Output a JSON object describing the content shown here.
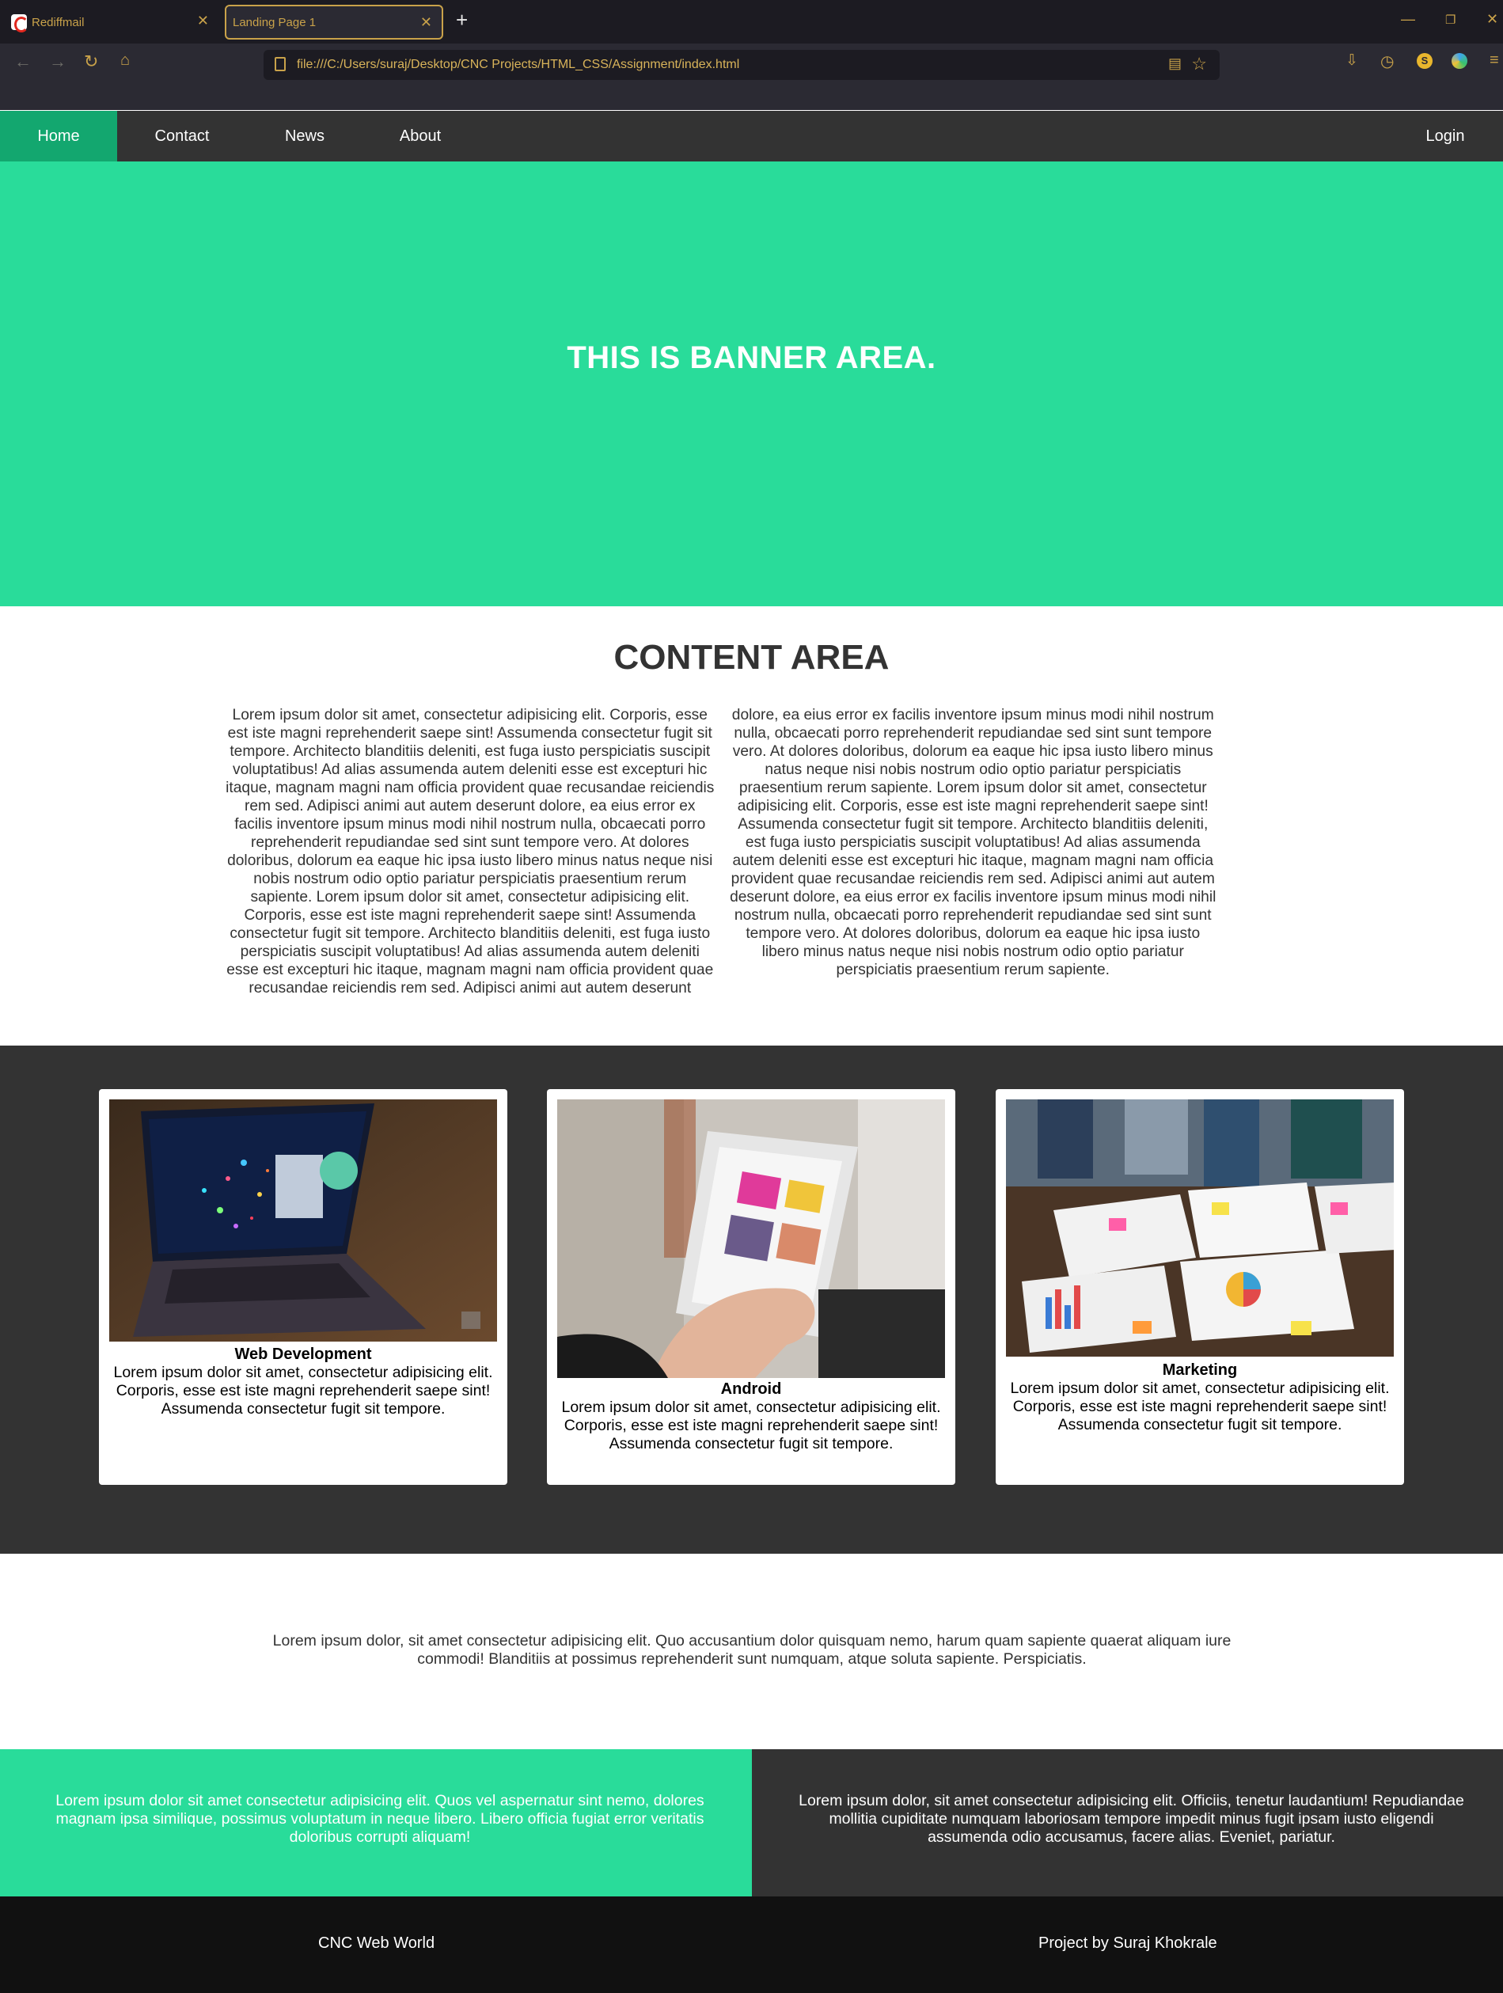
{
  "browser": {
    "tabs": [
      {
        "label": "Rediffmail",
        "active": false
      },
      {
        "label": "Landing Page 1",
        "active": true
      }
    ],
    "address": "file:///C:/Users/suraj/Desktop/CNC Projects/HTML_CSS/Assignment/index.html",
    "extension_badge": "S",
    "accent_color": "#c9a24a"
  },
  "nav": {
    "items": [
      "Home",
      "Contact",
      "News",
      "About"
    ],
    "login": "Login",
    "active_color": "#13a76f"
  },
  "banner": {
    "title": "THIS IS BANNER AREA.",
    "color": "#29dc9a"
  },
  "content": {
    "title": "CONTENT AREA",
    "body": "Lorem ipsum dolor sit amet, consectetur adipisicing elit. Corporis, esse est iste magni reprehenderit saepe sint! Assumenda consectetur fugit sit tempore. Architecto blanditiis deleniti, est fuga iusto perspiciatis suscipit voluptatibus! Ad alias assumenda autem deleniti esse est excepturi hic itaque, magnam magni nam officia provident quae recusandae reiciendis rem sed. Adipisci animi aut autem deserunt dolore, ea eius error ex facilis inventore ipsum minus modi nihil nostrum nulla, obcaecati porro reprehenderit repudiandae sed sint sunt tempore vero. At dolores doloribus, dolorum ea eaque hic ipsa iusto libero minus natus neque nisi nobis nostrum odio optio pariatur perspiciatis praesentium rerum sapiente. Lorem ipsum dolor sit amet, consectetur adipisicing elit. Corporis, esse est iste magni reprehenderit saepe sint! Assumenda consectetur fugit sit tempore. Architecto blanditiis deleniti, est fuga iusto perspiciatis suscipit voluptatibus! Ad alias assumenda autem deleniti esse est excepturi hic itaque, magnam magni nam officia provident quae recusandae reiciendis rem sed. Adipisci animi aut autem deserunt dolore, ea eius error ex facilis inventore ipsum minus modi nihil nostrum nulla, obcaecati porro reprehenderit repudiandae sed sint sunt tempore vero. At dolores doloribus, dolorum ea eaque hic ipsa iusto libero minus natus neque nisi nobis nostrum odio optio pariatur perspiciatis praesentium rerum sapiente. Lorem ipsum dolor sit amet, consectetur adipisicing elit. Corporis, esse est iste magni reprehenderit saepe sint! Assumenda consectetur fugit sit tempore. Architecto blanditiis deleniti, est fuga iusto perspiciatis suscipit voluptatibus! Ad alias assumenda autem deleniti esse est excepturi hic itaque, magnam magni nam officia provident quae recusandae reiciendis rem sed. Adipisci animi aut autem deserunt dolore, ea eius error ex facilis inventore ipsum minus modi nihil nostrum nulla, obcaecati porro reprehenderit repudiandae sed sint sunt tempore vero. At dolores doloribus, dolorum ea eaque hic ipsa iusto libero minus natus neque nisi nobis nostrum odio optio pariatur perspiciatis praesentium rerum sapiente."
  },
  "cards": [
    {
      "title": "Web Development",
      "text": "Lorem ipsum dolor sit amet, consectetur adipisicing elit. Corporis, esse est iste magni reprehenderit saepe sint! Assumenda consectetur fugit sit tempore.",
      "image": "laptop-photo"
    },
    {
      "title": "Android",
      "text": "Lorem ipsum dolor sit amet, consectetur adipisicing elit. Corporis, esse est iste magni reprehenderit saepe sint! Assumenda consectetur fugit sit tempore.",
      "image": "smartphone-photo"
    },
    {
      "title": "Marketing",
      "text": "Lorem ipsum dolor sit amet, consectetur adipisicing elit. Corporis, esse est iste magni reprehenderit saepe sint! Assumenda consectetur fugit sit tempore.",
      "image": "charts-table-photo"
    }
  ],
  "quote": "Lorem ipsum dolor, sit amet consectetur adipisicing elit. Quo accusantium dolor quisquam nemo, harum quam sapiente quaerat aliquam iure commodi! Blanditiis at possimus reprehenderit sunt numquam, atque soluta sapiente. Perspiciatis.",
  "split": {
    "left": "Lorem ipsum dolor sit amet consectetur adipisicing elit. Quos vel aspernatur sint nemo, dolores magnam ipsa similique, possimus voluptatum in neque libero. Libero officia fugiat error veritatis doloribus corrupti aliquam!",
    "right": "Lorem ipsum dolor, sit amet consectetur adipisicing elit. Officiis, tenetur laudantium! Repudiandae mollitia cupiditate numquam laboriosam tempore impedit minus fugit ipsam iusto eligendi assumenda odio accusamus, facere alias. Eveniet, pariatur."
  },
  "footer": {
    "left": "CNC Web World",
    "right": "Project by Suraj Khokrale"
  }
}
